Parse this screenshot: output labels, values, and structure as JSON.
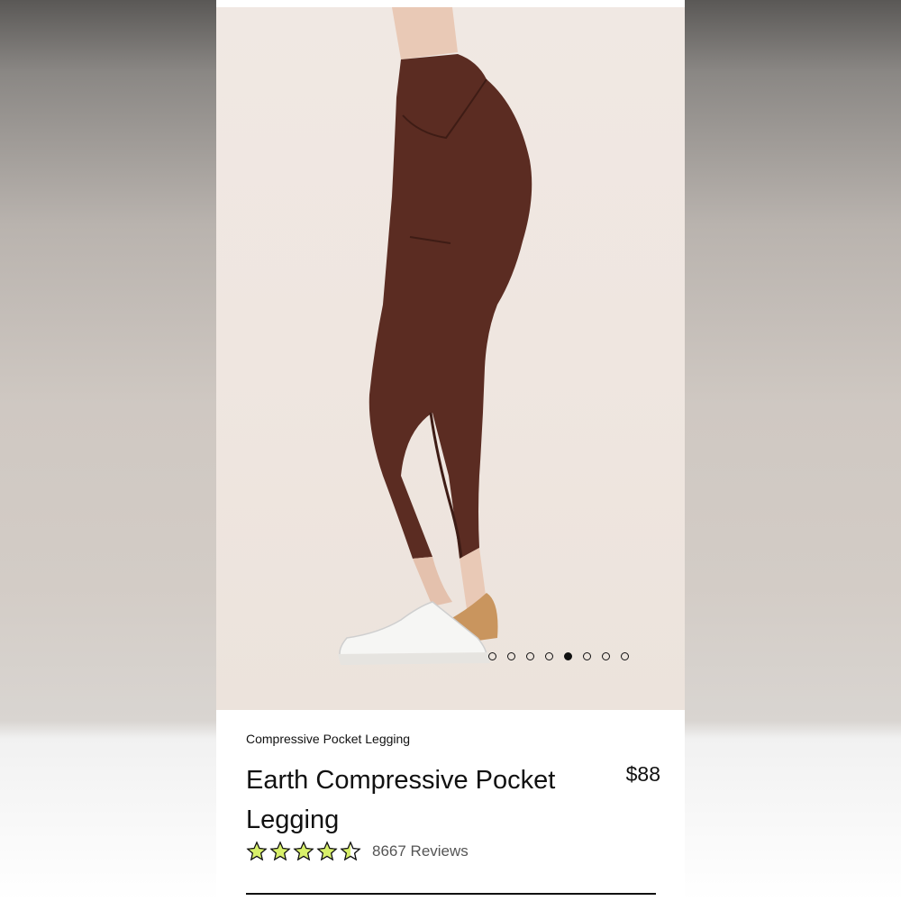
{
  "gallery": {
    "image_alt": "Earth Compressive Pocket Legging worn with white sneakers",
    "slide_count": 8,
    "active_slide": 5
  },
  "product": {
    "category": "Compressive Pocket Legging",
    "title": "Earth Compressive Pocket Legging",
    "price": "$88",
    "rating": 4.5,
    "rating_max": 5,
    "reviews": "8667 Reviews"
  },
  "colors": {
    "legging": "#5b2c22",
    "star_fill": "#d8f06a",
    "star_stroke": "#111111"
  }
}
